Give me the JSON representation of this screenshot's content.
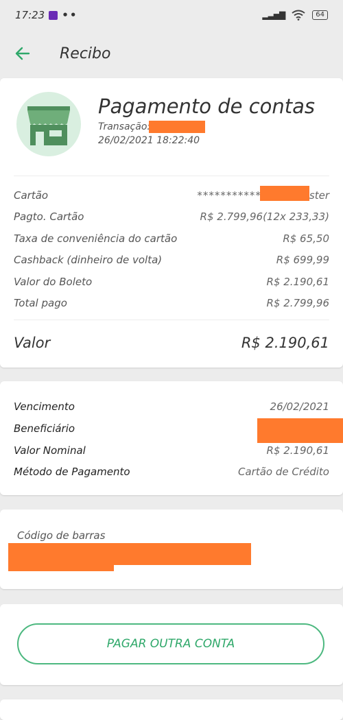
{
  "status_bar": {
    "time": "17:23",
    "dots": "••",
    "battery": "64"
  },
  "header": {
    "title": "Recibo",
    "back_icon": "arrow-left-icon"
  },
  "receipt": {
    "icon": "storefront-icon",
    "title": "Pagamento de contas",
    "transaction_label": "Transação:",
    "datetime": "26/02/2021 18:22:40"
  },
  "payment_details": [
    {
      "label": "Cartão",
      "value": "***********",
      "suffix": "ster"
    },
    {
      "label": "Pagto. Cartão",
      "value": "R$ 2.799,96(12x 233,33)"
    },
    {
      "label": "Taxa de conveniência do cartão",
      "value": "R$ 65,50"
    },
    {
      "label": "Cashback (dinheiro de volta)",
      "value": "R$ 699,99"
    },
    {
      "label": "Valor do Boleto",
      "value": "R$ 2.190,61"
    },
    {
      "label": "Total pago",
      "value": "R$ 2.799,96"
    }
  ],
  "total": {
    "label": "Valor",
    "value": "R$ 2.190,61"
  },
  "bill_details": [
    {
      "label": "Vencimento",
      "value": "26/02/2021"
    },
    {
      "label": "Beneficiário",
      "value": ""
    },
    {
      "label": "Valor Nominal",
      "value": "R$ 2.190,61"
    },
    {
      "label": "Método de Pagamento",
      "value": "Cartão de Crédito"
    }
  ],
  "barcode": {
    "label": "Código de barras"
  },
  "actions": {
    "pay_another": "PAGAR OUTRA CONTA"
  },
  "colors": {
    "accent": "#2fa86a",
    "redaction": "#ff7a2d",
    "avatar_bg": "#d9efe0"
  }
}
